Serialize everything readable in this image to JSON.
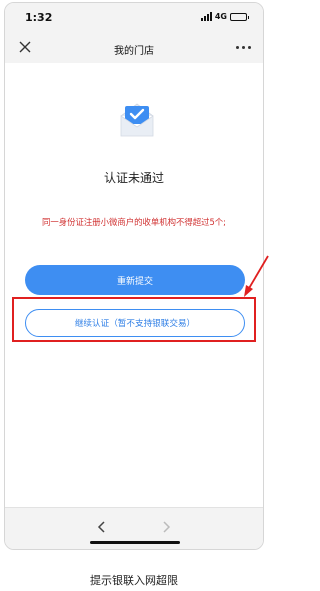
{
  "status_bar": {
    "time": "1:32",
    "network": "4G",
    "battery_level": 0.55
  },
  "nav": {
    "title": "我的门店"
  },
  "result": {
    "title": "认证未通过",
    "warning": "同一身份证注册小微商户的收单机构不得超过5个;"
  },
  "buttons": {
    "primary_label": "重新提交",
    "secondary_label": "继续认证（暂不支持银联交易）"
  },
  "caption": "提示银联入网超限",
  "colors": {
    "accent": "#3e8ef2",
    "warning": "#d03030",
    "annotation": "#e02020"
  }
}
